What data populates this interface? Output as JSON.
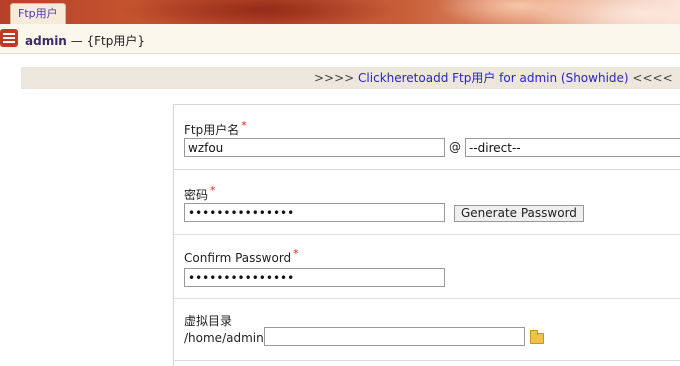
{
  "tab": {
    "label": "Ftp用户"
  },
  "titlebar": {
    "user": "admin",
    "separator": "—",
    "context": "{Ftp用户}"
  },
  "addbar": {
    "prefix": ">>>> ",
    "link": "Clickheretoadd Ftp用户 for admin (Showhide)",
    "suffix": " <<<<"
  },
  "form": {
    "username": {
      "label": "Ftp用户名",
      "required": "*",
      "value": "wzfou",
      "at": "@",
      "domain": "--direct--"
    },
    "password": {
      "label": "密码",
      "required": "*",
      "value": "wzfou1234567890",
      "generate_label": "Generate Password"
    },
    "confirm": {
      "label": "Confirm Password",
      "required": "*",
      "value": "wzfou1234567890"
    },
    "directory": {
      "label": "虚拟目录",
      "prefix": "/home/admin/",
      "value": ""
    }
  },
  "colors": {
    "accent": "#c23a25",
    "link": "#2a24c9",
    "required": "#e0241b"
  },
  "icons": [
    "app-menu-icon",
    "folder-icon"
  ]
}
